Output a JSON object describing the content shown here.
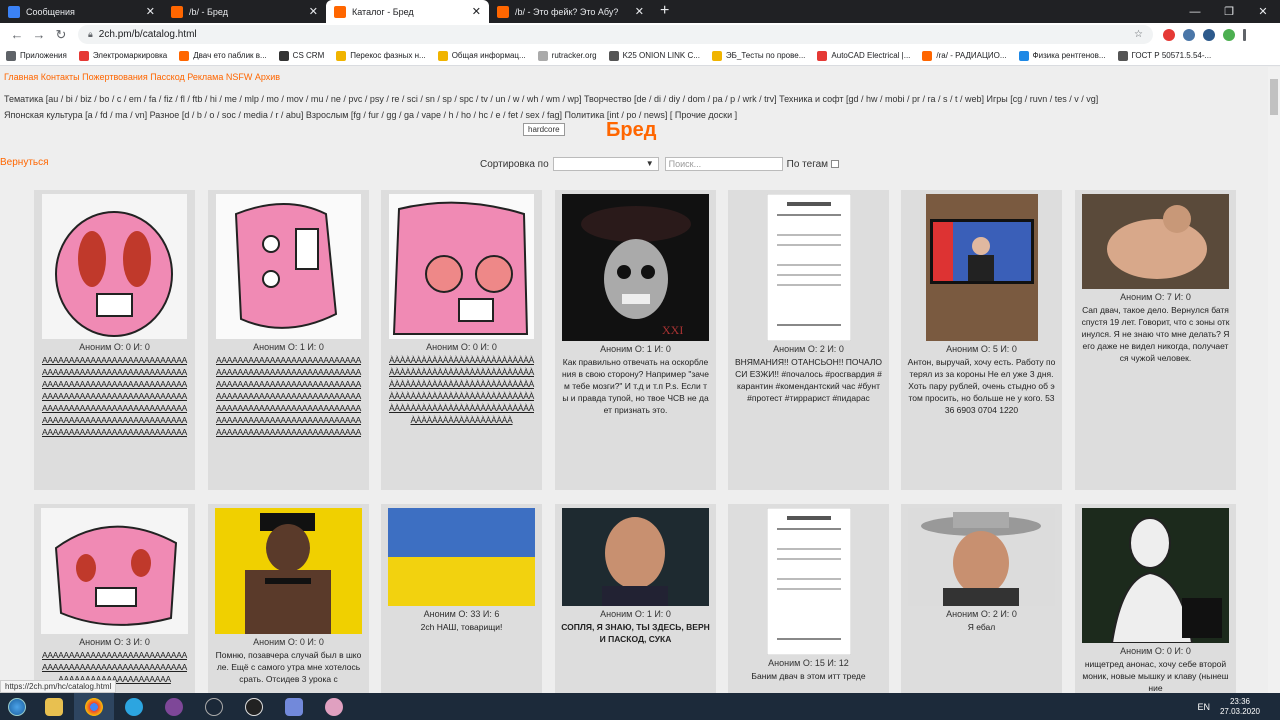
{
  "tabs": [
    {
      "title": "Сообщения",
      "color": "#3b82f6"
    },
    {
      "title": "/b/ - Бред",
      "color": "#ff6600"
    },
    {
      "title": "Каталог - Бред",
      "color": "#ff6600"
    },
    {
      "title": "/b/ - Это фейк? Это Абу?",
      "color": "#ff6600"
    }
  ],
  "url": "2ch.pm/b/catalog.html",
  "bookmarks": [
    "Приложения",
    "Электромаркировка",
    "Двач ето паблик в...",
    "CS CRM",
    "Перекос фазных н...",
    "Общая информац...",
    "rutracker.org",
    "K25 ONION LINK C...",
    "ЭБ_Тесты по прове...",
    "AutoCAD Electrical |...",
    "/ra/ - РАДИАЦИО...",
    "Физика рентгенов...",
    "ГОСТ Р 50571.5.54-..."
  ],
  "topnav": "Главная Контакты Пожертвования Пасскод Реклама NSFW Архив",
  "boardlist": {
    "line1": "Тематика [au / bi / biz / bo / c / em / fa / fiz / fl / ftb / hi / me / mlp / mo / mov / mu / ne / pvc / psy / re / sci / sn / sp / spc / tv / un / w / wh / wm / wp] Творчество [de / di / diy / dom / pa / p / wrk / trv] Техника и софт [gd / hw / mobi / pr / ra / s / t / web] Игры [cg / ruvn / tes / v / vg]",
    "line2": "Японская культура [a / fd / ma / vn] Разное [d / b / o / soc / media / r / abu] Взрослым [fg / fur / gg / ga / vape / h / ho / hc / e / fet / sex / fag] Политика [int / po / news] [ Прочие доски ]"
  },
  "hardcore_label": "hardcore",
  "board_title": "Бред",
  "back_label": "Вернуться",
  "sort_label": "Сортировка по",
  "search_placeholder": "Поиск...",
  "tags_label": "По тегам",
  "cards": [
    {
      "meta": "Аноним  О: 0 И: 0",
      "text": "ААААААААААААААААААААААААААААААААААААААААААААААААААААААААААААААААААААААААААААААААААААААААААААААААААААААААААААААААААААААААААААААААААААААААААААААААААААААААААААААААААААААААААААААААААААААААААААА"
    },
    {
      "meta": "Аноним  О: 1 И: 0",
      "text": "ААААААААААААААААААААААААААААААААААААААААААААААААААААААААААААААААААААААААААААААААААААААААААААААААААААААААААААААААААААААААААААААААААААААААААААААААААААААААААААААААААААААААААААААААААААААААААААА"
    },
    {
      "meta": "Аноним  О: 0 И: 0",
      "text": "ÀÀÀÀÀÀÀÀÀÀÀÀÀÀÀÀÀÀÀÀÀÀÀÀÀÀÀÀÀÀÀÀÀÀÀÀÀÀÀÀÀÀÀÀÀÀÀÀÀÀÀÀÀÀÀÀÀÀÀÀÀÀÀÀÀÀÀÀÀÀÀÀÀÀÀÀÀÀÀÀÀÀÀÀÀÀÀÀÀÀÀÀÀÀÀÀÀÀÀÀÀÀÀÀÀÀÀÀÀÀÀÀÀÀÀÀÀÀÀÀÀÀÀÀÀÀÀÀÀÀÀÀÀÀÀÀÀÀÀÀÀÀÀÀÀÀÀÀÀÀÀÀÀÀ"
    },
    {
      "meta": "Аноним  О: 1 И: 0",
      "text": "Как правильно отвечать на оскорбления в свою сторону? Например \"зачем тебе мозги?\" И т.д и т.п P.s. Если ты и правда тупой, но твое ЧСВ не дает признать это."
    },
    {
      "meta": "Аноним  О: 2 И: 0",
      "text": "ВНЯМАНИЯ!! ОТАНСЬОН!! ПОЧАЛОСИ ЕЗЖИ!! #почалось #росгвардия #карантин #комендантский час #бунт #протест #тиррарист #пидарас"
    },
    {
      "meta": "Аноним  О: 5 И: 0",
      "text": "Антон, выручай, хочу есть. Работу потерял из за короны Не ел уже 3 дня. Хоть пару рублей, очень стыдно об этом просить, но больше не у кого. 5336 6903 0704 1220"
    },
    {
      "meta": "Аноним  О: 7 И: 0",
      "text": "Сап двач, такое дело. Вернулся батя спустя 19 лет. Говорит, что с зоны откинулся. Я не знаю что мне делать? Я его даже не видел никогда, получается чужой человек."
    },
    {
      "meta": "Аноним  О: 3 И: 0",
      "text": "ААААААААААААААААААААААААААААААААААААААААААААААААААААААААААААААААААААААААААА"
    },
    {
      "meta": "Аноним  О: 0 И: 0",
      "text": "Помню, позавчера случай был в школе. Ещё с самого утра мне хотелось срать. Отсидев 3 урока с"
    },
    {
      "meta": "Аноним  О: 33 И: 6",
      "text": "2ch НАШ, товарищи!"
    },
    {
      "meta": "Аноним  О: 1 И: 0",
      "text": "СОПЛЯ, Я ЗНАЮ, ТЫ ЗДЕСЬ, ВЕРНИ ПАСКОД, СУКА"
    },
    {
      "meta": "Аноним  О: 15 И: 12",
      "text": "Баним двач в этом итт треде"
    },
    {
      "meta": "Аноним  О: 2 И: 0",
      "text": "Я ебал"
    },
    {
      "meta": "Аноним  О: 0 И: 0",
      "text": "нищетред анонас, хочу себе второй моник, новые мышку и клаву (нынешние"
    }
  ],
  "status_url": "https://2ch.pm/hc/catalog.html",
  "tray": {
    "lang": "EN",
    "time": "23:36",
    "date": "27.03.2020"
  }
}
